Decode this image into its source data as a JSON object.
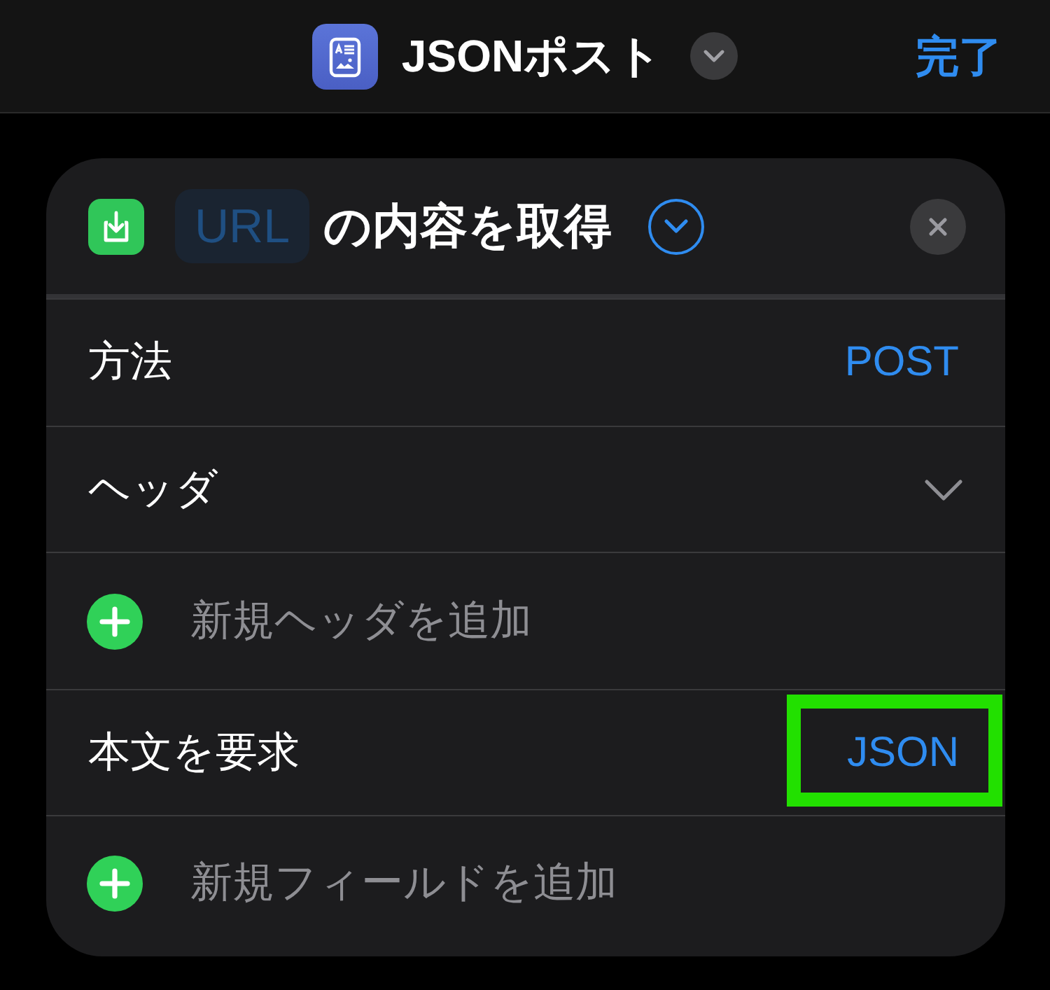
{
  "title_bar": {
    "title": "JSONポスト",
    "done": "完了"
  },
  "action": {
    "url_field": {
      "placeholder": "URL"
    },
    "title": "の内容を取得"
  },
  "rows": [
    {
      "kind": "value",
      "label": "方法",
      "value": "POST",
      "highlighted": false
    },
    {
      "kind": "disclosure",
      "label": "ヘッダ",
      "expanded": false
    },
    {
      "kind": "add",
      "label": "新規ヘッダを追加"
    },
    {
      "kind": "value",
      "label": "本文を要求",
      "value": "JSON",
      "highlighted": true
    },
    {
      "kind": "add",
      "label": "新規フィールドを追加"
    }
  ]
}
